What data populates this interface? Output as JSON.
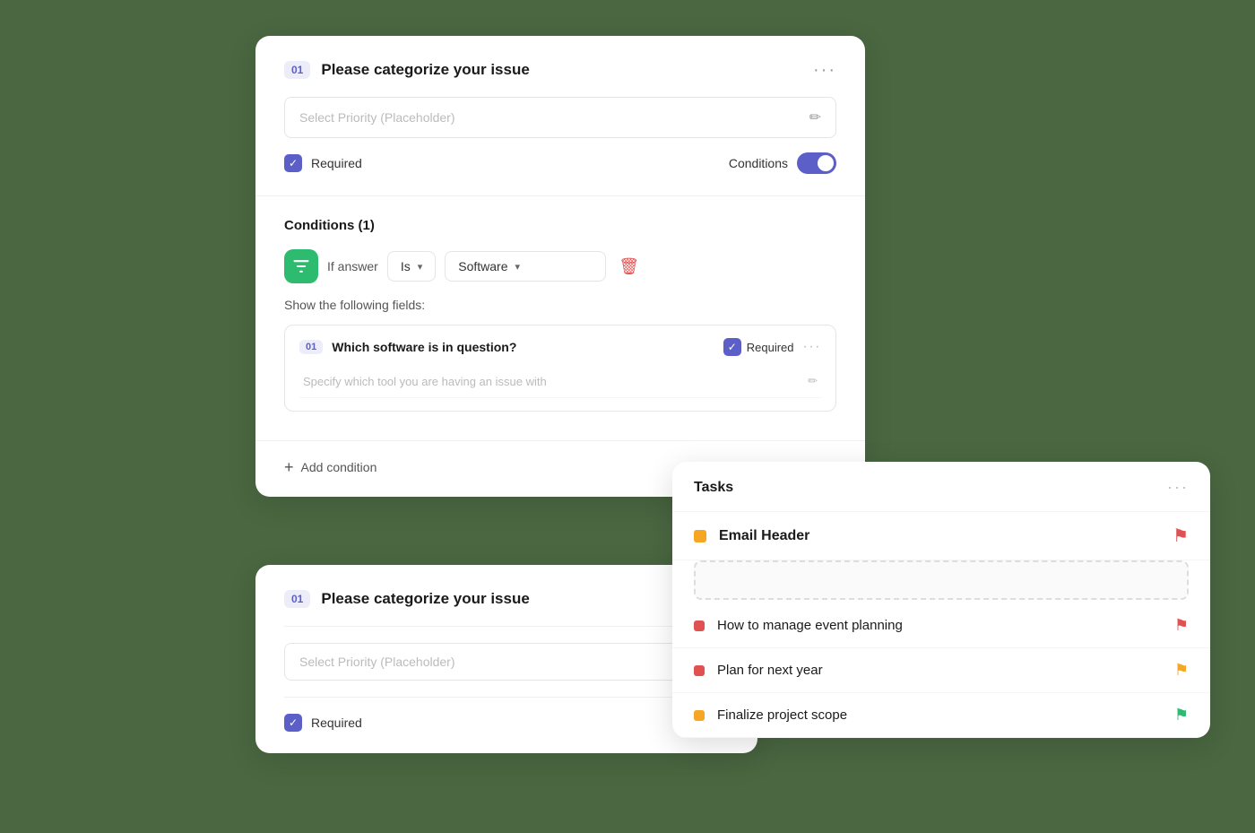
{
  "primaryCard": {
    "section1": {
      "stepBadge": "01",
      "title": "Please categorize your issue",
      "moreBtn": "···",
      "selectPlaceholder": "Select Priority (Placeholder)",
      "requiredLabel": "Required",
      "conditionsLabel": "Conditions"
    },
    "conditionsSection": {
      "title": "Conditions (1)",
      "ifAnswerText": "If answer",
      "isLabel": "Is",
      "softwareLabel": "Software",
      "showFieldsLabel": "Show the following fields:",
      "nestedField": {
        "stepBadge": "01",
        "title": "Which software is in question?",
        "requiredLabel": "Required",
        "moreBtnLabel": "···",
        "placeholder": "Specify which tool you are having an issue with"
      }
    },
    "addCondition": {
      "label": "Add condition"
    }
  },
  "secondaryCard": {
    "stepBadge": "01",
    "title": "Please categorize your issue",
    "selectPlaceholder": "Select Priority (Placeholder)",
    "requiredLabel": "Required"
  },
  "tasksCard": {
    "title": "Tasks",
    "moreBtn": "···",
    "emailHeader": {
      "label": "Email Header"
    },
    "tasks": [
      {
        "label": "How to manage event planning",
        "dotColor": "red",
        "flagColor": "red"
      },
      {
        "label": "Plan for next year",
        "dotColor": "red",
        "flagColor": "yellow"
      },
      {
        "label": "Finalize project scope",
        "dotColor": "yellow",
        "flagColor": "green"
      }
    ]
  },
  "icons": {
    "edit": "✏",
    "check": "✓",
    "chevron": "▾",
    "delete": "🗑",
    "plus": "+",
    "flag": "⚑",
    "filter": "⇄"
  }
}
